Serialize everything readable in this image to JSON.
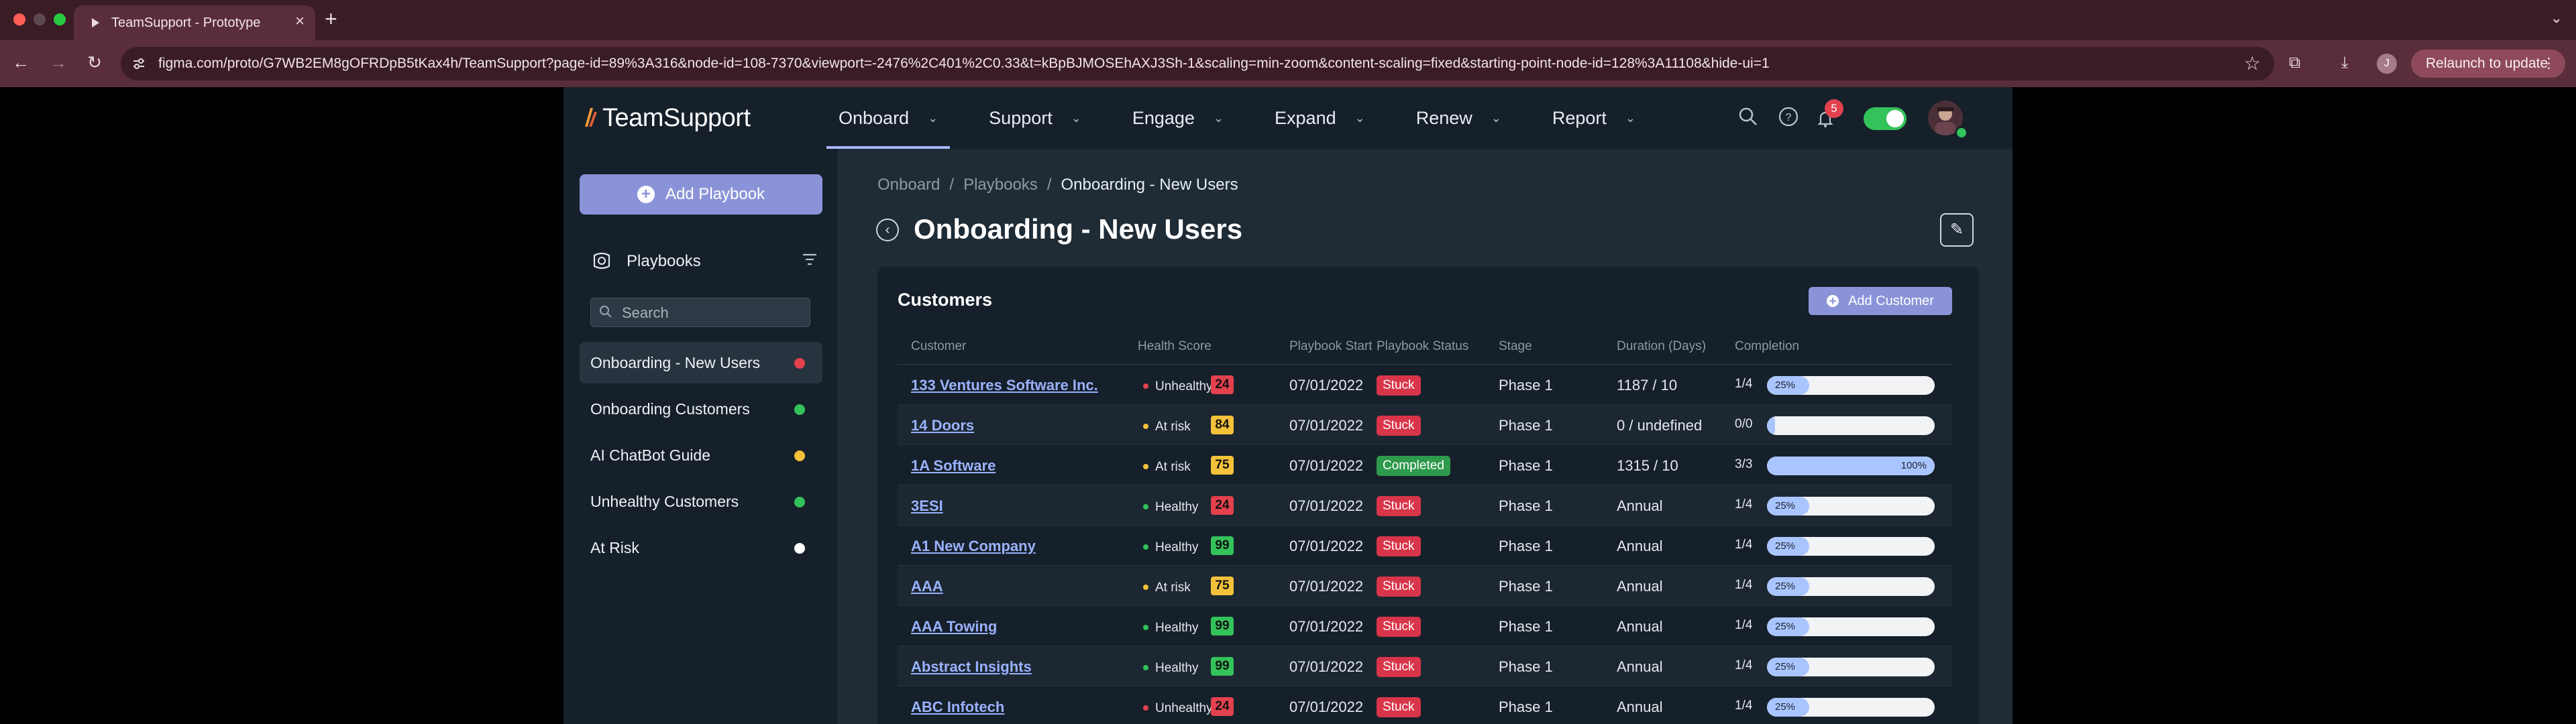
{
  "browser": {
    "tab_title": "TeamSupport - Prototype",
    "url": "figma.com/proto/G7WB2EM8gOFRDpB5tKax4h/TeamSupport?page-id=89%3A316&node-id=108-7370&viewport=-2476%2C401%2C0.33&t=kBpBJMOSEhAXJ3Sh-1&scaling=min-zoom&content-scaling=fixed&starting-point-node-id=128%3A11108&hide-ui=1",
    "profile_initial": "J",
    "relaunch_label": "Relaunch to update"
  },
  "app": {
    "logo": "TeamSupport",
    "nav": [
      {
        "label": "Onboard",
        "active": true
      },
      {
        "label": "Support"
      },
      {
        "label": "Engage"
      },
      {
        "label": "Expand"
      },
      {
        "label": "Renew"
      },
      {
        "label": "Report"
      }
    ],
    "notification_count": "5"
  },
  "sidebar": {
    "add_playbook_label": "Add Playbook",
    "playbooks_label": "Playbooks",
    "search_placeholder": "Search",
    "items": [
      {
        "label": "Onboarding - New Users",
        "color": "#e2414d",
        "selected": true
      },
      {
        "label": "Onboarding Customers",
        "color": "#34c25a"
      },
      {
        "label": "AI ChatBot Guide",
        "color": "#f3c13a"
      },
      {
        "label": "Unhealthy Customers",
        "color": "#34c25a"
      },
      {
        "label": "At Risk",
        "color": "#ffffff"
      }
    ]
  },
  "main": {
    "breadcrumb": [
      "Onboard",
      "Playbooks",
      "Onboarding - New Users"
    ],
    "title": "Onboarding - New Users",
    "card_title": "Customers",
    "add_customer_label": "Add Customer",
    "columns": [
      "Customer",
      "Health Score",
      "Playbook Start",
      "Playbook Status",
      "Stage",
      "Duration (Days)",
      "Completion"
    ],
    "rows": [
      {
        "customer": "133 Ventures Software Inc.",
        "health": "Unhealthy",
        "health_color": "#e2414d",
        "score": "24",
        "score_color": "#e2414d",
        "start": "07/01/2022",
        "status": "Stuck",
        "status_color": "#d8354a",
        "stage": "Phase 1",
        "duration": "1187 / 10",
        "completion": "1/4",
        "percent": 25,
        "percent_label": "25%"
      },
      {
        "customer": "14 Doors",
        "health": "At risk",
        "health_color": "#f3c13a",
        "score": "84",
        "score_color": "#f3c13a",
        "start": "07/01/2022",
        "status": "Stuck",
        "status_color": "#d8354a",
        "stage": "Phase 1",
        "duration": "0 / undefined",
        "completion": "0/0",
        "percent": 0,
        "percent_label": ""
      },
      {
        "customer": "1A Software",
        "health": "At risk",
        "health_color": "#f3c13a",
        "score": "75",
        "score_color": "#f3c13a",
        "start": "07/01/2022",
        "status": "Completed",
        "status_color": "#2e9a4b",
        "stage": "Phase 1",
        "duration": "1315 / 10",
        "completion": "3/3",
        "percent": 100,
        "percent_label": "100%"
      },
      {
        "customer": "3ESI",
        "health": "Healthy",
        "health_color": "#34c25a",
        "score": "24",
        "score_color": "#e2414d",
        "start": "07/01/2022",
        "status": "Stuck",
        "status_color": "#d8354a",
        "stage": "Phase 1",
        "duration": "Annual",
        "completion": "1/4",
        "percent": 25,
        "percent_label": "25%"
      },
      {
        "customer": "A1 New Company",
        "health": "Healthy",
        "health_color": "#34c25a",
        "score": "99",
        "score_color": "#34c25a",
        "start": "07/01/2022",
        "status": "Stuck",
        "status_color": "#d8354a",
        "stage": "Phase 1",
        "duration": "Annual",
        "completion": "1/4",
        "percent": 25,
        "percent_label": "25%"
      },
      {
        "customer": "AAA",
        "health": "At risk",
        "health_color": "#f3c13a",
        "score": "75",
        "score_color": "#f3c13a",
        "start": "07/01/2022",
        "status": "Stuck",
        "status_color": "#d8354a",
        "stage": "Phase 1",
        "duration": "Annual",
        "completion": "1/4",
        "percent": 25,
        "percent_label": "25%"
      },
      {
        "customer": "AAA Towing",
        "health": "Healthy",
        "health_color": "#34c25a",
        "score": "99",
        "score_color": "#34c25a",
        "start": "07/01/2022",
        "status": "Stuck",
        "status_color": "#d8354a",
        "stage": "Phase 1",
        "duration": "Annual",
        "completion": "1/4",
        "percent": 25,
        "percent_label": "25%"
      },
      {
        "customer": "Abstract Insights",
        "health": "Healthy",
        "health_color": "#34c25a",
        "score": "99",
        "score_color": "#34c25a",
        "start": "07/01/2022",
        "status": "Stuck",
        "status_color": "#d8354a",
        "stage": "Phase 1",
        "duration": "Annual",
        "completion": "1/4",
        "percent": 25,
        "percent_label": "25%"
      },
      {
        "customer": "ABC Infotech",
        "health": "Unhealthy",
        "health_color": "#e2414d",
        "score": "24",
        "score_color": "#e2414d",
        "start": "07/01/2022",
        "status": "Stuck",
        "status_color": "#d8354a",
        "stage": "Phase 1",
        "duration": "Annual",
        "completion": "1/4",
        "percent": 25,
        "percent_label": "25%"
      }
    ]
  }
}
